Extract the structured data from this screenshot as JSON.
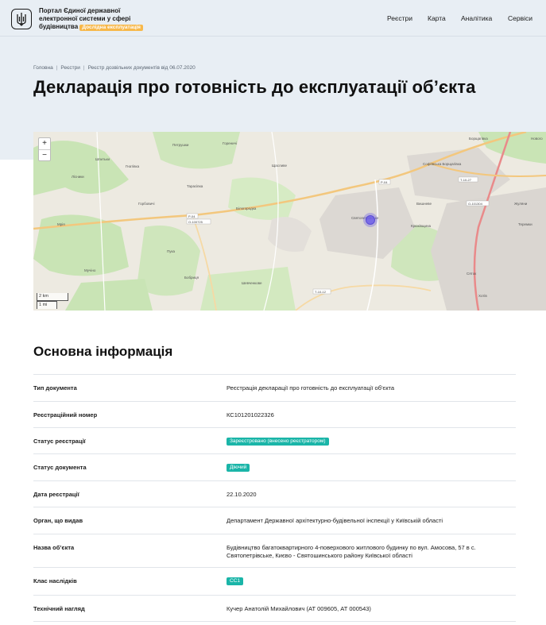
{
  "header": {
    "brand_line1": "Портал Єдиної державної",
    "brand_line2": "електронної системи у сфері",
    "brand_line3": "будівництва",
    "beta_label": "Дослідна експлуатація",
    "nav": [
      "Реєстри",
      "Карта",
      "Аналітика",
      "Сервіси"
    ]
  },
  "breadcrumb": [
    "Головна",
    "Реєстри",
    "Реєстр дозвільних документів від 06.07.2020"
  ],
  "page_title": "Декларація про готовність до експлуатації об’єкта",
  "map": {
    "zoom_in": "+",
    "zoom_out": "−",
    "scale_km": "2 km",
    "scale_mi": "1 mi",
    "places": [
      "Петрушки",
      "Гореничі",
      "Шпитьки",
      "Лісники",
      "Гнатівка",
      "Тарасівка",
      "Горбовичі",
      "Мрія",
      "Щасливе",
      "Білогородка",
      "Пука",
      "Мучіно",
      "Бобриця",
      "Шевченкове",
      "Святопетрівське",
      "Вишневе",
      "Крюківщина",
      "Софіївська Борщагівка",
      "Борщагівка",
      "Жуляни",
      "Теремки",
      "Сяток",
      "Хотів",
      "Нового"
    ],
    "roads": [
      "P-04",
      "О-100725",
      "P-04",
      "Т-10-27",
      "О-101304",
      "Т-10-12"
    ]
  },
  "section_title": "Основна інформація",
  "rows": [
    {
      "label": "Тип документа",
      "value": "Реєстрація декларації про готовність до експлуатації об'єкта",
      "type": "text"
    },
    {
      "label": "Реєстраційний номер",
      "value": "КС101201022326",
      "type": "text"
    },
    {
      "label": "Статус реєстрації",
      "value": "Зареєстровано (внесено реєстратором)",
      "type": "badge"
    },
    {
      "label": "Статус документа",
      "value": "Діючий",
      "type": "badge"
    },
    {
      "label": "Дата реєстрації",
      "value": "22.10.2020",
      "type": "text"
    },
    {
      "label": "Орган, що видав",
      "value": "Департамент Державної архітектурно-будівельної інспекції у Київській області",
      "type": "text"
    },
    {
      "label": "Назва об’єкта",
      "value": "Будівництво багатоквартирного 4-поверхового житлового будинку по вул. Амосова, 57 в с. Святопетрівське, Києво - Святошинського району Київської області",
      "type": "text"
    },
    {
      "label": "Клас наслідків",
      "value": "СС1",
      "type": "badge"
    },
    {
      "label": "Технічний нагляд",
      "value": "Кучер Анатолій Михайлович (АТ 009605, АТ 000543)",
      "type": "text"
    }
  ],
  "colors": {
    "accent": "#1ab5a8",
    "beta": "#f7b84b",
    "hero_bg": "#e8eef4",
    "marker": "#6b5de8"
  }
}
